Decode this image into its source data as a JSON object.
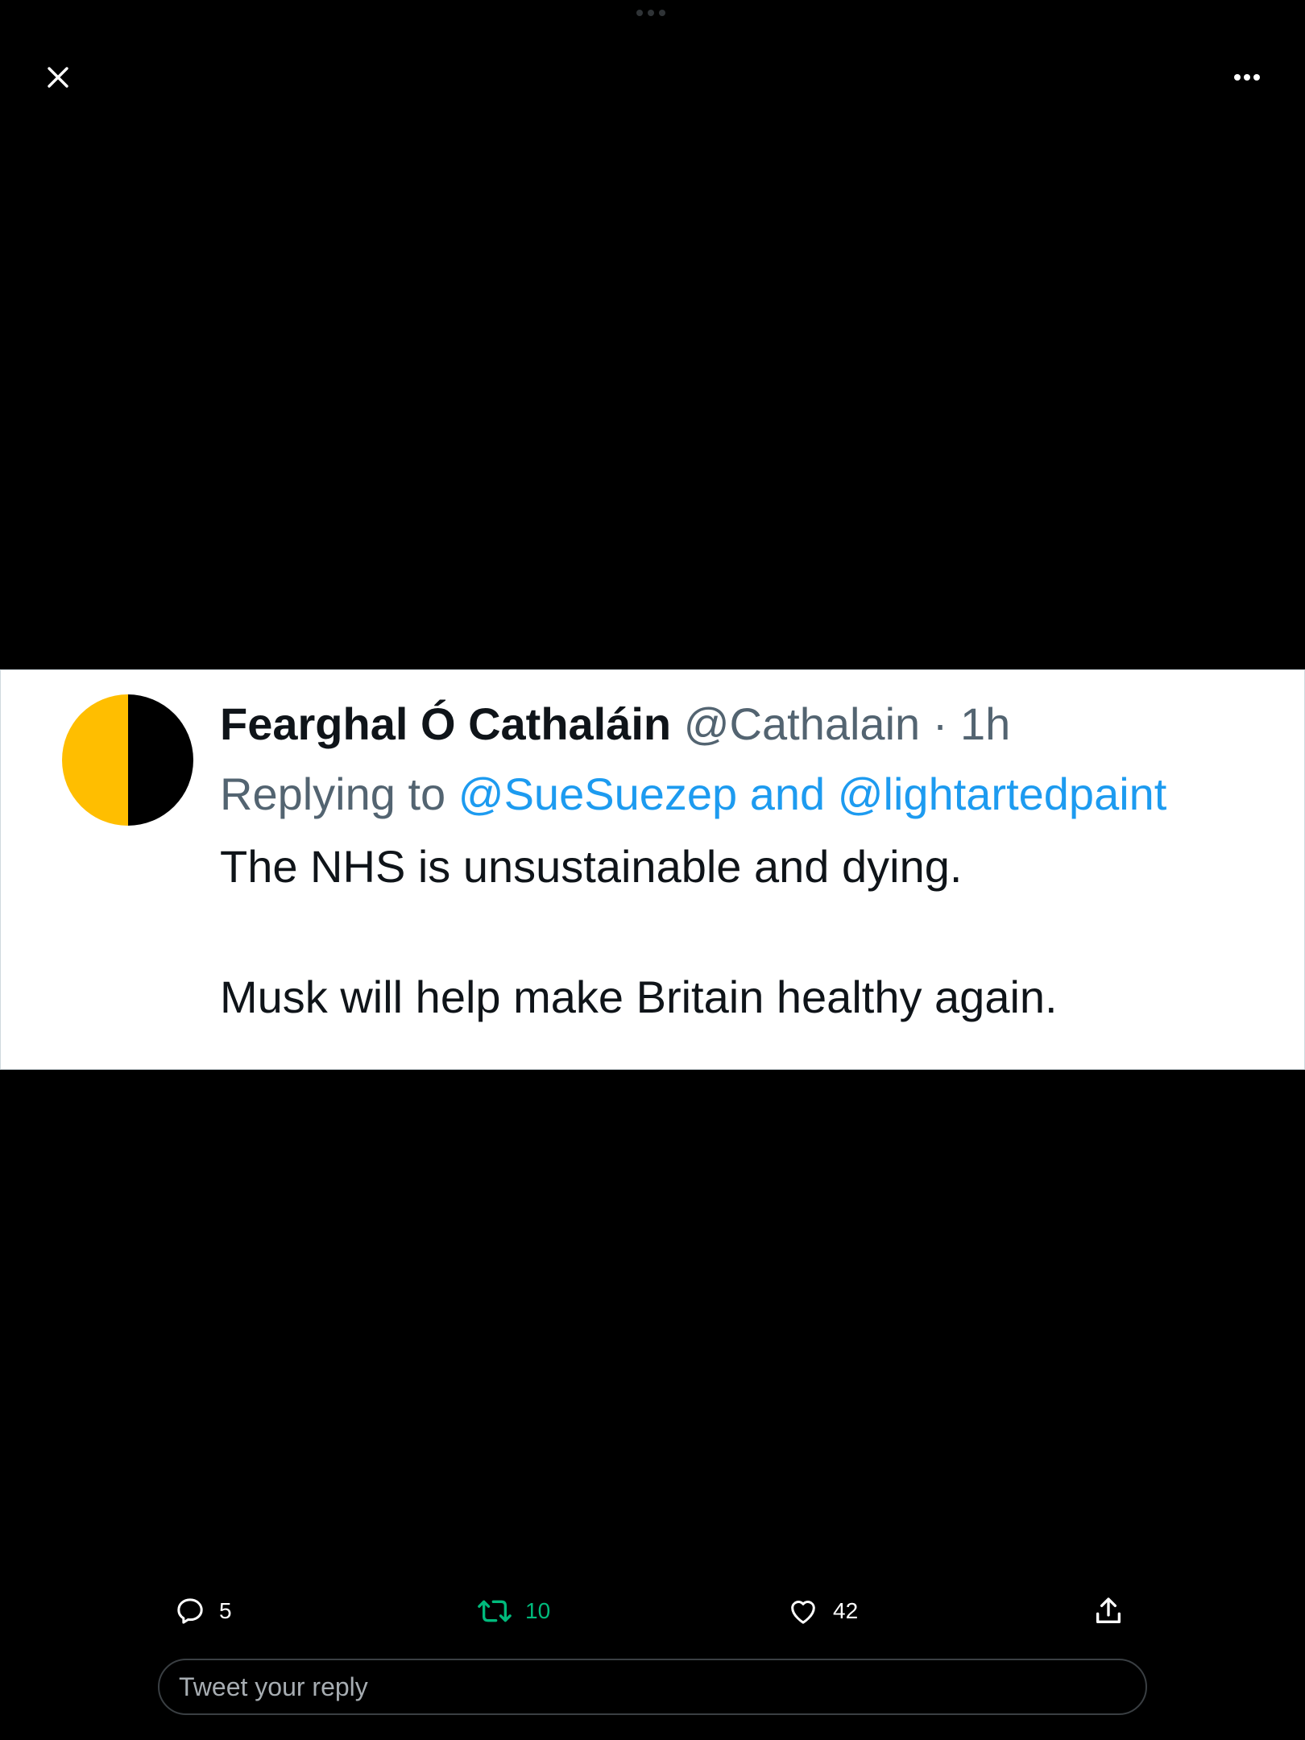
{
  "viewer": {
    "close_label": "Close",
    "more_label": "More"
  },
  "tweet_image": {
    "avatar_colors": {
      "left": "#ffbe00",
      "right": "#000000"
    },
    "author_name": "Fearghal Ó Cathaláin",
    "author_handle": "@Cathalain",
    "separator": "·",
    "age": "1h",
    "replying_to_prefix": "Replying to",
    "replying_to_targets": "@SueSuezep and @lightartedpaint",
    "text_line_1": "The NHS is unsustainable and dying.",
    "text_line_2": "Musk will help make Britain healthy again."
  },
  "actions": {
    "reply_count": "5",
    "retweet_count": "10",
    "like_count": "42",
    "icons": {
      "reply": "reply-icon",
      "retweet": "retweet-icon",
      "like": "heart-icon",
      "share": "share-icon"
    },
    "retweet_color": "#00ba7c"
  },
  "reply_box": {
    "placeholder": "Tweet your reply"
  }
}
